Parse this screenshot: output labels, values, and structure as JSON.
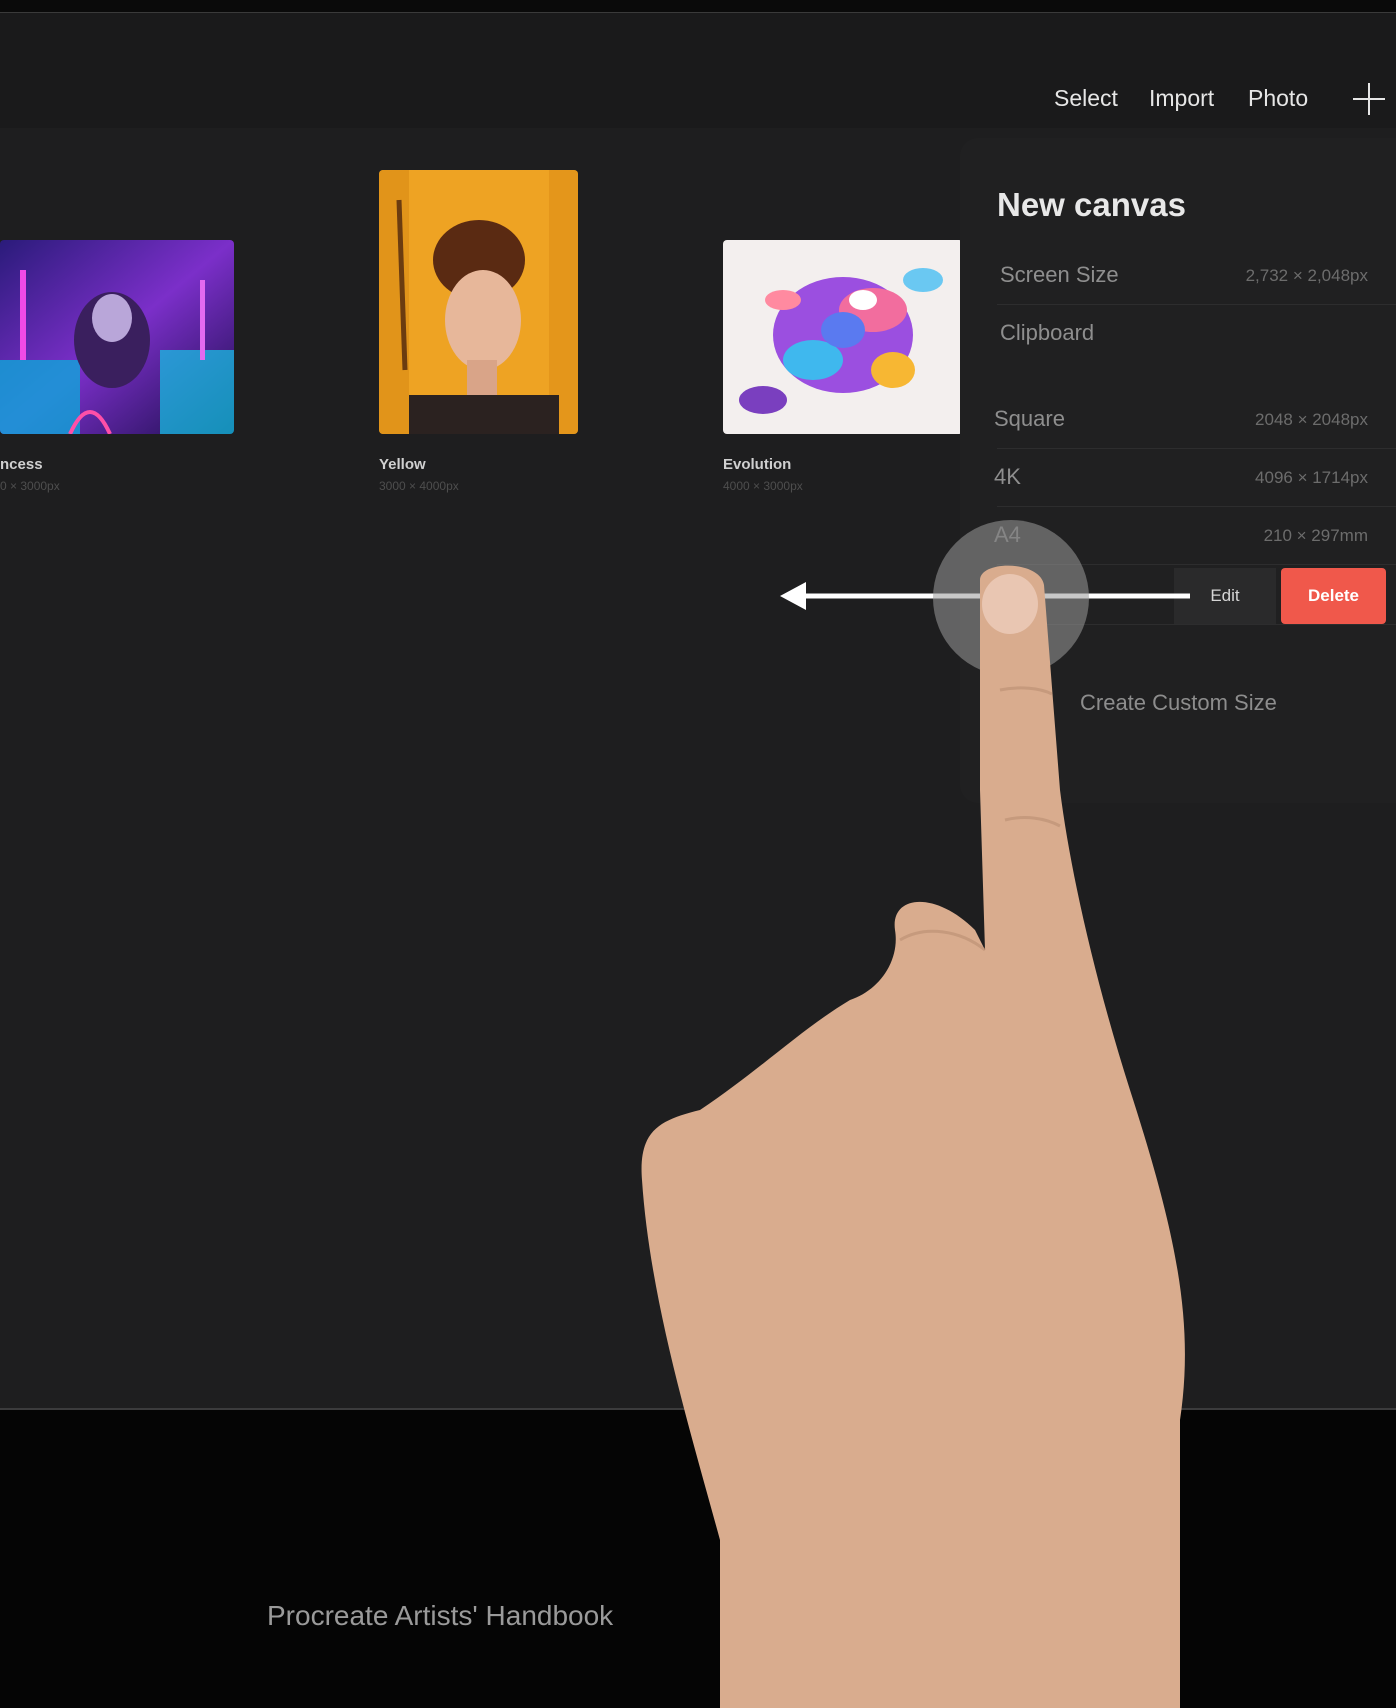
{
  "toolbar": {
    "select_label": "Select",
    "import_label": "Import",
    "photo_label": "Photo",
    "new_icon": "plus-icon"
  },
  "gallery": {
    "items": [
      {
        "title": "ncess",
        "dims": "0 × 3000px"
      },
      {
        "title": "Yellow",
        "dims": "3000 × 4000px"
      },
      {
        "title": "Evolution",
        "dims": "4000 × 3000px"
      }
    ]
  },
  "new_canvas": {
    "title": "New canvas",
    "rows": [
      {
        "name": "Screen Size",
        "dims": "2,732 × 2,048px"
      },
      {
        "name": "Clipboard",
        "dims": ""
      },
      {
        "name": "Square",
        "dims": "2048 × 2048px"
      },
      {
        "name": "4K",
        "dims": "4096 × 1714px"
      },
      {
        "name": "A4",
        "dims": "210 × 297mm"
      }
    ],
    "edit_label": "Edit",
    "delete_label": "Delete",
    "delete_color": "#f0584b",
    "create_custom_label": "Create Custom Size"
  },
  "gesture": {
    "direction": "swipe-left",
    "touch_icon": "touch-point-icon",
    "arrow_icon": "arrow-left-icon"
  },
  "footer": {
    "text": "Procreate Artists' Handbook"
  }
}
